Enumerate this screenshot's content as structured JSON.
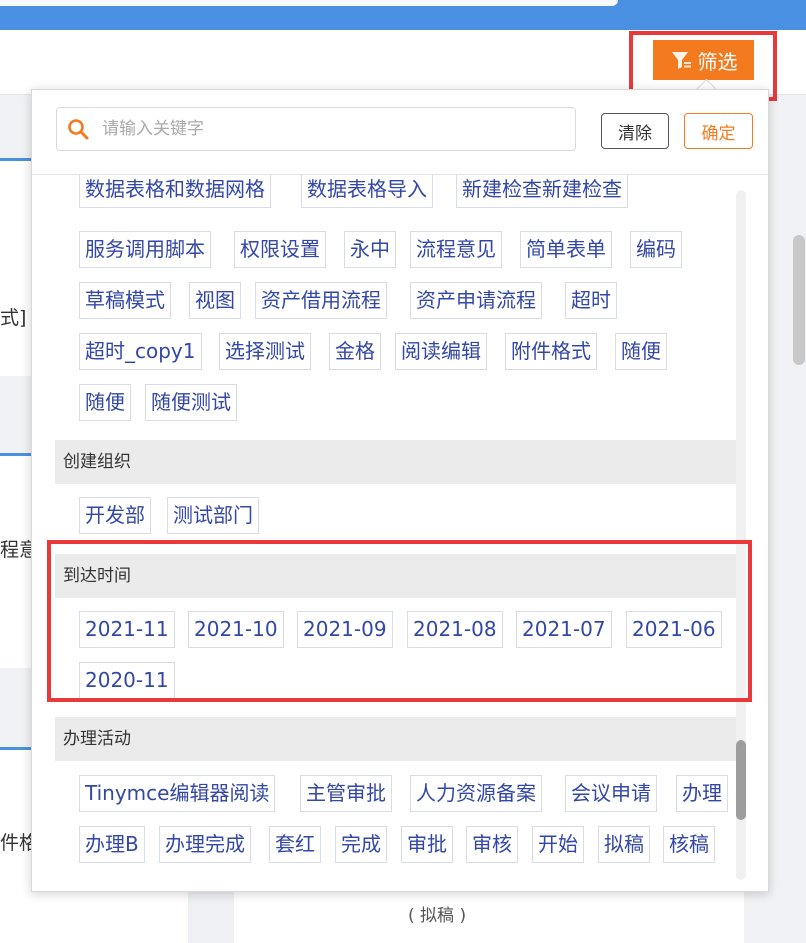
{
  "header": {
    "filter_label": "筛选",
    "filter_icon": "funnel-icon"
  },
  "background": {
    "card_texts": [
      "式]",
      "程意",
      "件格"
    ],
    "footer_text": "( 拟稿 )"
  },
  "filter_panel": {
    "search": {
      "placeholder": "请输入关键字",
      "value": "",
      "icon": "search-icon"
    },
    "clear_label": "清除",
    "confirm_label": "确定",
    "colors": {
      "accent": "#f47a1f",
      "tag_text": "#3347a8",
      "highlight": "#e8393b"
    },
    "top_tags": [
      "数据表格和数据网格",
      "数据表格导入",
      "新建检查新建检查",
      "服务调用脚本",
      "权限设置",
      "永中",
      "流程意见",
      "简单表单",
      "编码",
      "草稿模式",
      "视图",
      "资产借用流程",
      "资产申请流程",
      "超时",
      "超时_copy1",
      "选择测试",
      "金格",
      "阅读编辑",
      "附件格式",
      "随便",
      "随便",
      "随便测试"
    ],
    "sections": [
      {
        "title": "创建组织",
        "tags": [
          "开发部",
          "测试部门"
        ]
      },
      {
        "title": "到达时间",
        "tags": [
          "2021-11",
          "2021-10",
          "2021-09",
          "2021-08",
          "2021-07",
          "2021-06",
          "2020-11"
        ]
      },
      {
        "title": "办理活动",
        "tags": [
          "Tinymce编辑器阅读",
          "主管审批",
          "人力资源备案",
          "会议申请",
          "办理",
          "办理B",
          "办理完成",
          "套红",
          "完成",
          "审批",
          "审核",
          "开始",
          "拟稿",
          "核稿"
        ]
      }
    ]
  }
}
